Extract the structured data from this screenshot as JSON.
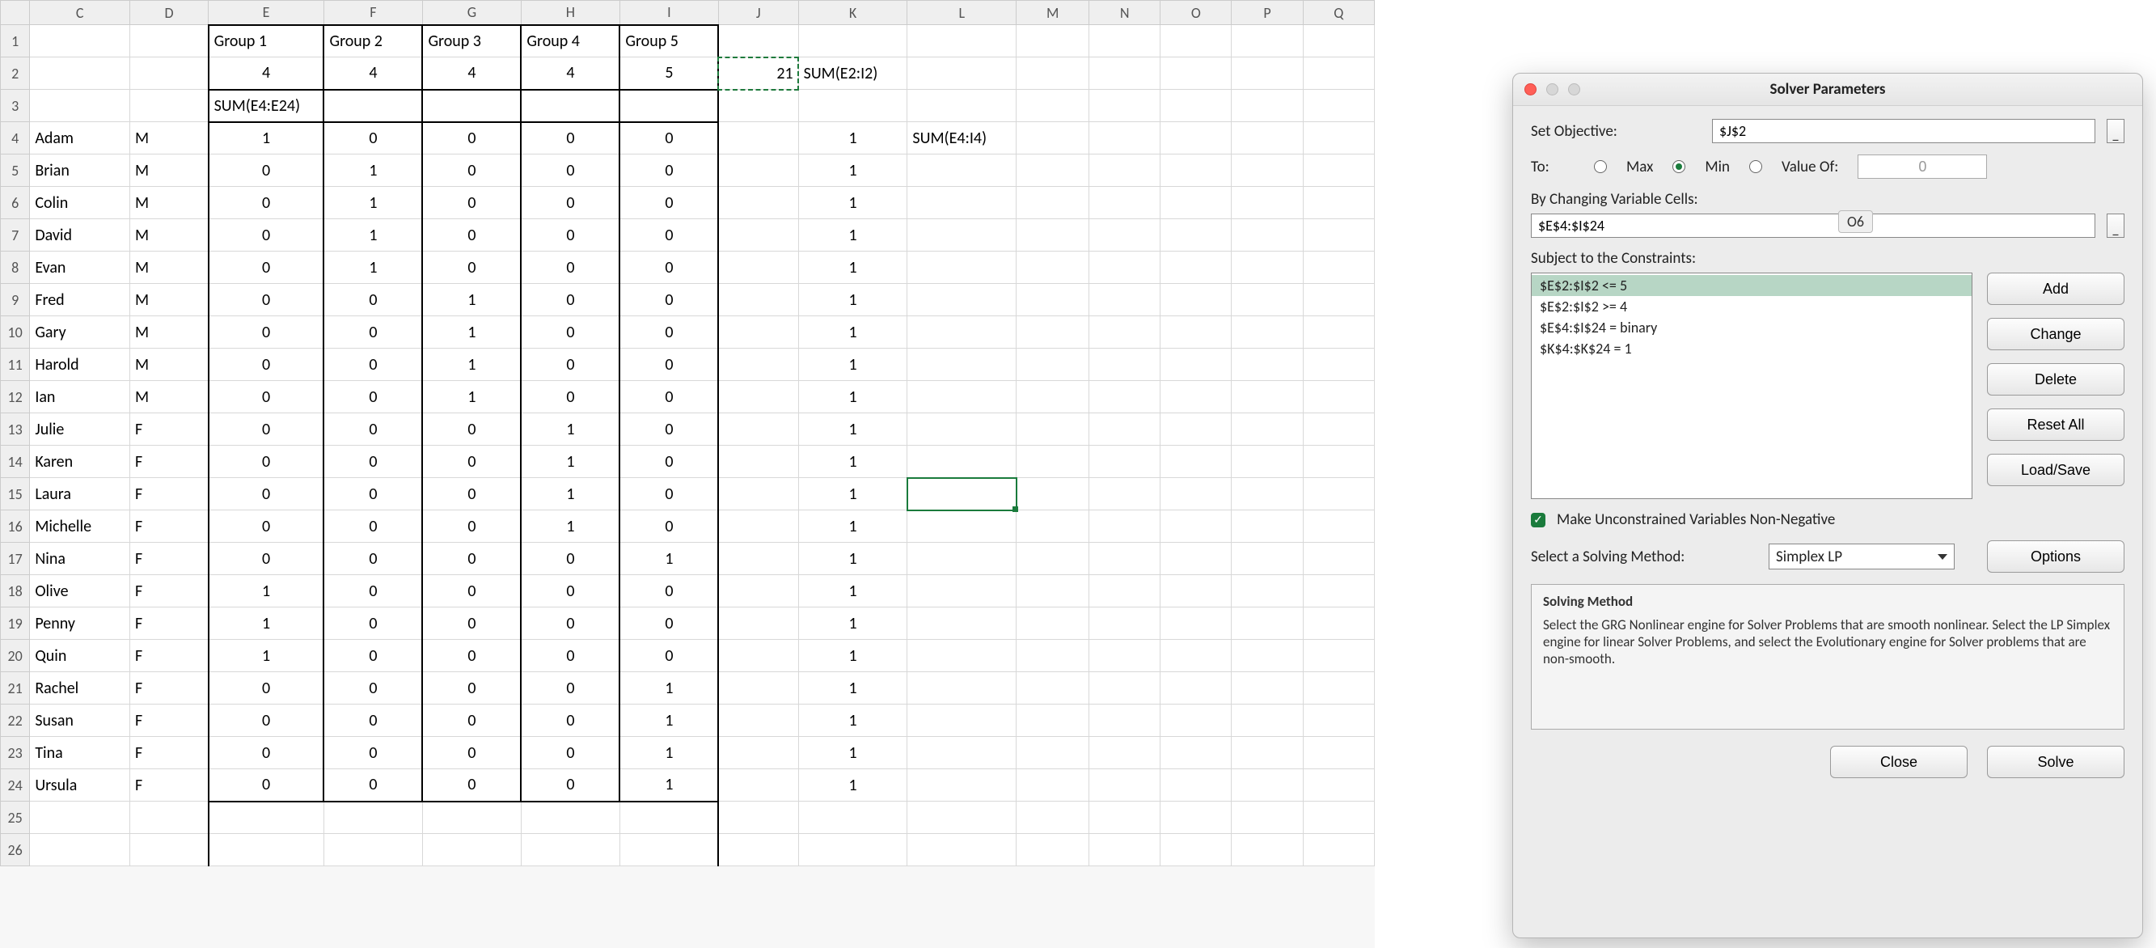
{
  "columns": [
    "C",
    "D",
    "E",
    "F",
    "G",
    "H",
    "I",
    "J",
    "K",
    "L",
    "M",
    "N",
    "O",
    "P",
    "Q"
  ],
  "col_widths": {
    "C": 166,
    "D": 166,
    "E": 166,
    "F": 166,
    "G": 166,
    "H": 166,
    "I": 166,
    "J": 166,
    "K": 166,
    "L": 166,
    "M": 166,
    "N": 166,
    "O": 166,
    "P": 166,
    "Q": 166
  },
  "row_count": 26,
  "selected_col": "L",
  "selected_row": 15,
  "header_labels": {
    "E": "Group 1",
    "F": "Group 2",
    "G": "Group 3",
    "H": "Group 4",
    "I": "Group 5"
  },
  "group_sums": {
    "E": 4,
    "F": 4,
    "G": 4,
    "H": 4,
    "I": 5
  },
  "j2_value": 21,
  "k2_formula": "SUM(E2:I2)",
  "e3_formula": "SUM(E4:E24)",
  "l4_formula": "SUM(E4:I4)",
  "people": [
    {
      "name": "Adam",
      "sex": "M",
      "g": [
        1,
        0,
        0,
        0,
        0
      ],
      "k": 1
    },
    {
      "name": "Brian",
      "sex": "M",
      "g": [
        0,
        1,
        0,
        0,
        0
      ],
      "k": 1
    },
    {
      "name": "Colin",
      "sex": "M",
      "g": [
        0,
        1,
        0,
        0,
        0
      ],
      "k": 1
    },
    {
      "name": "David",
      "sex": "M",
      "g": [
        0,
        1,
        0,
        0,
        0
      ],
      "k": 1
    },
    {
      "name": "Evan",
      "sex": "M",
      "g": [
        0,
        1,
        0,
        0,
        0
      ],
      "k": 1
    },
    {
      "name": "Fred",
      "sex": "M",
      "g": [
        0,
        0,
        1,
        0,
        0
      ],
      "k": 1
    },
    {
      "name": "Gary",
      "sex": "M",
      "g": [
        0,
        0,
        1,
        0,
        0
      ],
      "k": 1
    },
    {
      "name": "Harold",
      "sex": "M",
      "g": [
        0,
        0,
        1,
        0,
        0
      ],
      "k": 1
    },
    {
      "name": "Ian",
      "sex": "M",
      "g": [
        0,
        0,
        1,
        0,
        0
      ],
      "k": 1
    },
    {
      "name": "Julie",
      "sex": "F",
      "g": [
        0,
        0,
        0,
        1,
        0
      ],
      "k": 1
    },
    {
      "name": "Karen",
      "sex": "F",
      "g": [
        0,
        0,
        0,
        1,
        0
      ],
      "k": 1
    },
    {
      "name": "Laura",
      "sex": "F",
      "g": [
        0,
        0,
        0,
        1,
        0
      ],
      "k": 1
    },
    {
      "name": "Michelle",
      "sex": "F",
      "g": [
        0,
        0,
        0,
        1,
        0
      ],
      "k": 1
    },
    {
      "name": "Nina",
      "sex": "F",
      "g": [
        0,
        0,
        0,
        0,
        1
      ],
      "k": 1
    },
    {
      "name": "Olive",
      "sex": "F",
      "g": [
        1,
        0,
        0,
        0,
        0
      ],
      "k": 1
    },
    {
      "name": "Penny",
      "sex": "F",
      "g": [
        1,
        0,
        0,
        0,
        0
      ],
      "k": 1
    },
    {
      "name": "Quin",
      "sex": "F",
      "g": [
        1,
        0,
        0,
        0,
        0
      ],
      "k": 1
    },
    {
      "name": "Rachel",
      "sex": "F",
      "g": [
        0,
        0,
        0,
        0,
        1
      ],
      "k": 1
    },
    {
      "name": "Susan",
      "sex": "F",
      "g": [
        0,
        0,
        0,
        0,
        1
      ],
      "k": 1
    },
    {
      "name": "Tina",
      "sex": "F",
      "g": [
        0,
        0,
        0,
        0,
        1
      ],
      "k": 1
    },
    {
      "name": "Ursula",
      "sex": "F",
      "g": [
        0,
        0,
        0,
        0,
        1
      ],
      "k": 1
    }
  ],
  "dialog": {
    "title": "Solver Parameters",
    "set_objective_label": "Set Objective:",
    "objective_value": "$J$2",
    "to_label": "To:",
    "max_label": "Max",
    "min_label": "Min",
    "valueof_label": "Value Of:",
    "valueof_value": "0",
    "by_changing_label": "By Changing Variable Cells:",
    "changing_value": "$E$4:$I$24",
    "tooltip_text": "O6",
    "constraints_label": "Subject to the Constraints:",
    "constraints": [
      "$E$2:$I$2 <= 5",
      "$E$2:$I$2 >= 4",
      "$E$4:$I$24 = binary",
      "$K$4:$K$24 = 1"
    ],
    "btn_add": "Add",
    "btn_change": "Change",
    "btn_delete": "Delete",
    "btn_resetall": "Reset All",
    "btn_loadsave": "Load/Save",
    "make_nonneg_label": "Make Unconstrained Variables Non-Negative",
    "method_label": "Select a Solving Method:",
    "method_value": "Simplex LP",
    "btn_options": "Options",
    "solving_method_header": "Solving Method",
    "solving_method_text": "Select the GRG Nonlinear engine for Solver Problems that are smooth nonlinear. Select the LP Simplex engine for linear Solver Problems, and select the Evolutionary engine for Solver problems that are non-smooth.",
    "btn_close": "Close",
    "btn_solve": "Solve"
  }
}
